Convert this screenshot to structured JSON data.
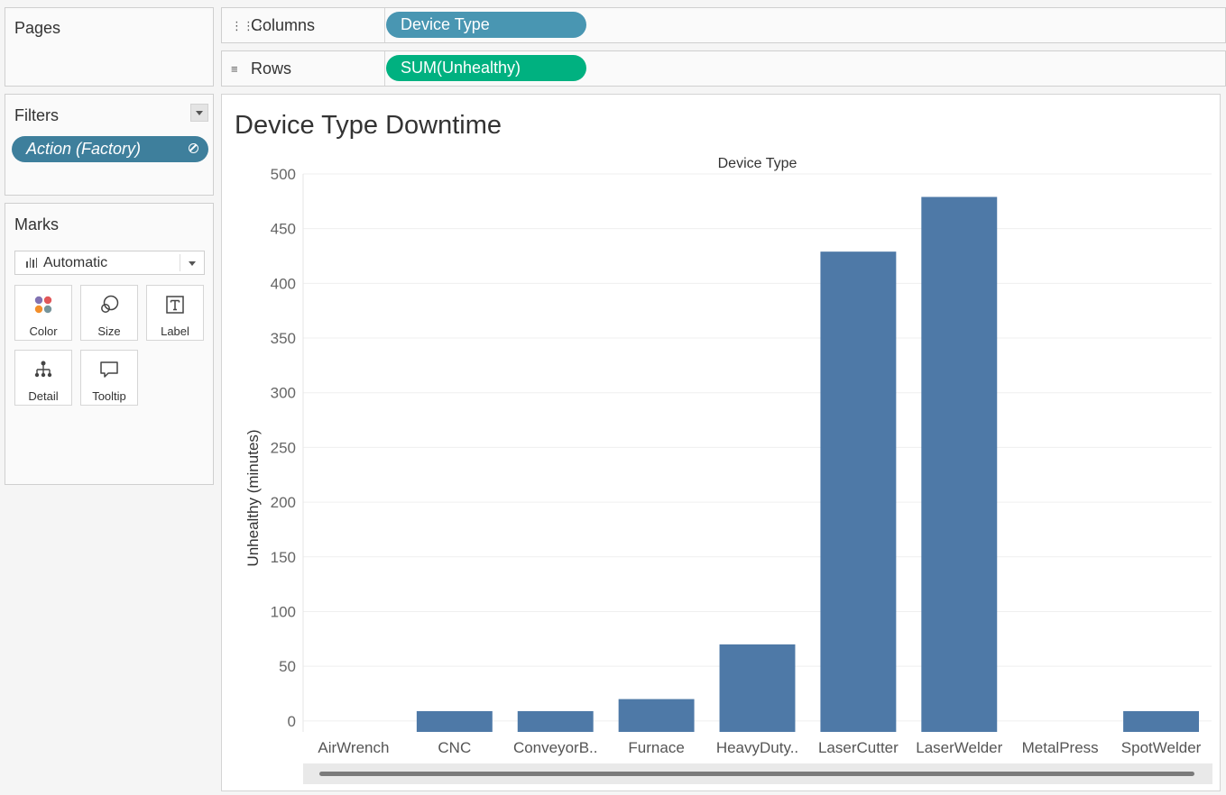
{
  "pages": {
    "title": "Pages"
  },
  "filters": {
    "title": "Filters",
    "pill_label": "Action (Factory)"
  },
  "marks": {
    "title": "Marks",
    "mark_type": "Automatic",
    "buttons": [
      {
        "label": "Color",
        "icon": "color-icon"
      },
      {
        "label": "Size",
        "icon": "size-icon"
      },
      {
        "label": "Label",
        "icon": "label-icon"
      },
      {
        "label": "Detail",
        "icon": "detail-icon"
      },
      {
        "label": "Tooltip",
        "icon": "tooltip-icon"
      }
    ]
  },
  "shelves": {
    "columns": {
      "label": "Columns",
      "pill": "Device Type"
    },
    "rows": {
      "label": "Rows",
      "pill": "SUM(Unhealthy)"
    }
  },
  "colors": {
    "bar": "#4e79a7",
    "columns_pill": "#4996b2",
    "rows_pill": "#00b180",
    "filter_pill": "#3e7f9c"
  },
  "chart_data": {
    "type": "bar",
    "title": "Device Type Downtime",
    "xlabel": "Device Type",
    "ylabel": "Unhealthy (minutes)",
    "categories": [
      "AirWrench",
      "CNC",
      "ConveyorB..",
      "Furnace",
      "HeavyDuty..",
      "LaserCutter",
      "LaserWelder",
      "MetalPress",
      "SpotWelder"
    ],
    "values": [
      0,
      9,
      9,
      20,
      70,
      429,
      479,
      0,
      9
    ],
    "ylim": [
      -10,
      500
    ],
    "yticks": [
      0,
      50,
      100,
      150,
      200,
      250,
      300,
      350,
      400,
      450,
      500
    ],
    "grid": true,
    "legend": "none"
  }
}
